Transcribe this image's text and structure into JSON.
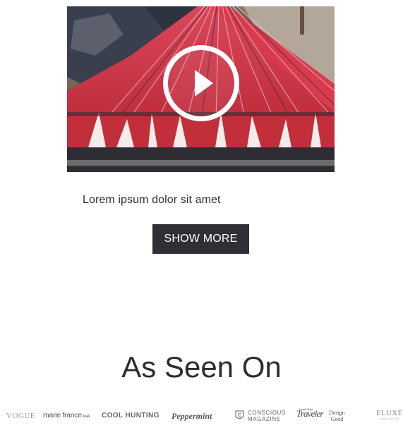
{
  "video": {
    "thumbnail_description": "",
    "play_icon": "play-icon"
  },
  "caption": "Lorem ipsum dolor sit amet",
  "show_more_label": "SHOW MORE",
  "as_seen_on": {
    "title": "As Seen On",
    "logos": [
      {
        "name": "vogue",
        "text": "VOGUE"
      },
      {
        "name": "marie-france",
        "text": "marie france",
        "sub": "ASIA"
      },
      {
        "name": "cool-hunting",
        "text": "COOL HUNTING"
      },
      {
        "name": "peppermint",
        "text": "Peppermint"
      },
      {
        "name": "conscious-magazine",
        "line1": "CONSCIOUS",
        "line2": "MAGAZINE"
      },
      {
        "name": "traveler",
        "text": "Traveler",
        "sub": "Condé Nast"
      },
      {
        "name": "design-good",
        "line1": "Design",
        "line2": "Good"
      },
      {
        "name": "eluxe",
        "text": "ELUXE",
        "sub": "MAGAZINE"
      }
    ]
  },
  "colors": {
    "button_bg": "#2e3035",
    "button_text": "#ffffff",
    "text": "#2b2d31",
    "thread_red": "#c9303c"
  }
}
